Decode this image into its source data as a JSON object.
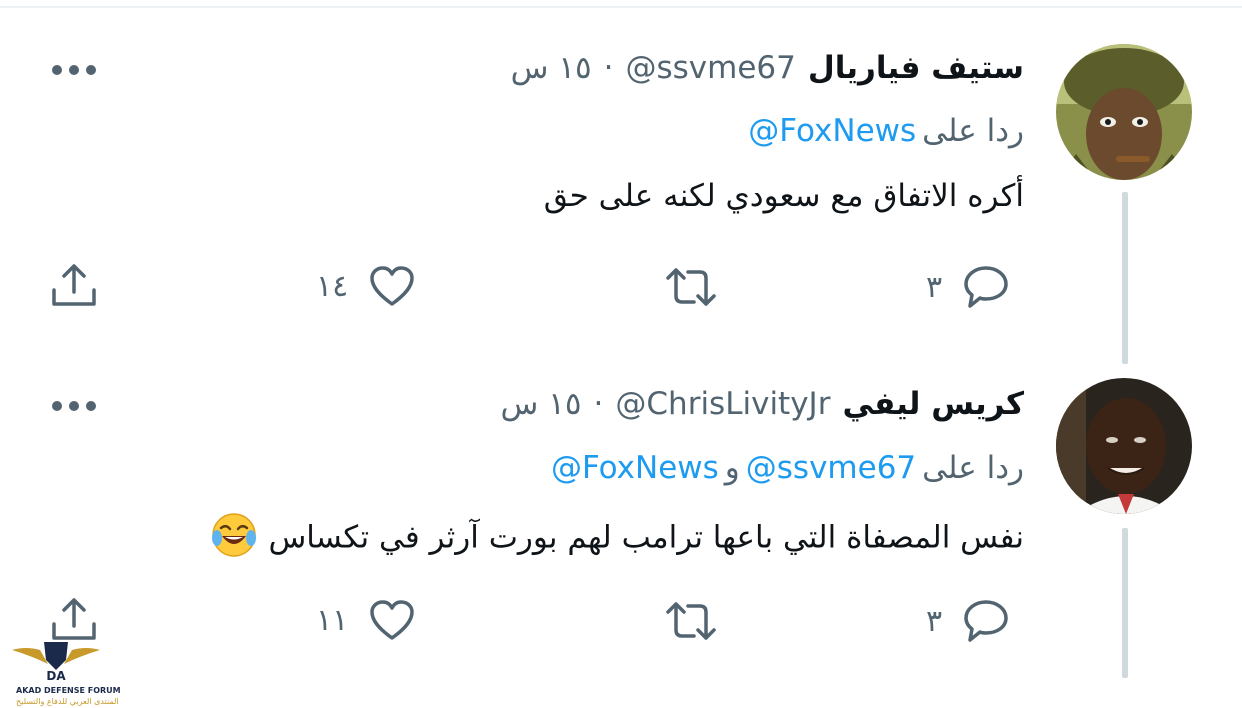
{
  "tweets": [
    {
      "name": "ستيف فياريال",
      "handle": "@ssvme67",
      "separator": "·",
      "time": "١٥ س",
      "reply_prefix": "ردا على",
      "mentions": [
        "@FoxNews"
      ],
      "conjunction": "",
      "text": "أكره الاتفاق مع سعودي لكنه على حق",
      "replies": "٣",
      "likes": "١٤"
    },
    {
      "name": "كريس ليفي",
      "handle": "@ChrisLivityJr",
      "separator": "·",
      "time": "١٥ س",
      "reply_prefix": "ردا على",
      "mentions": [
        "@ssvme67",
        "@FoxNews"
      ],
      "conjunction": "و",
      "text": "نفس المصفاة التي باعها ترامب لهم بورت آرثر في تكساس",
      "replies": "٣",
      "likes": "١١"
    }
  ],
  "icons": {
    "reply": "reply-icon",
    "retweet": "retweet-icon",
    "like": "heart-icon",
    "share": "share-icon",
    "more": "more-dots-icon",
    "emoji": "laughing-tears-emoji"
  },
  "watermark": {
    "line1": "AKAD DEFENSE FORUM",
    "line2": "المنتدى العربي للدفاع والتسليح"
  },
  "colors": {
    "accent": "#1d9bf0",
    "secondary_text": "#536471",
    "thread_line": "#cfd9de"
  }
}
